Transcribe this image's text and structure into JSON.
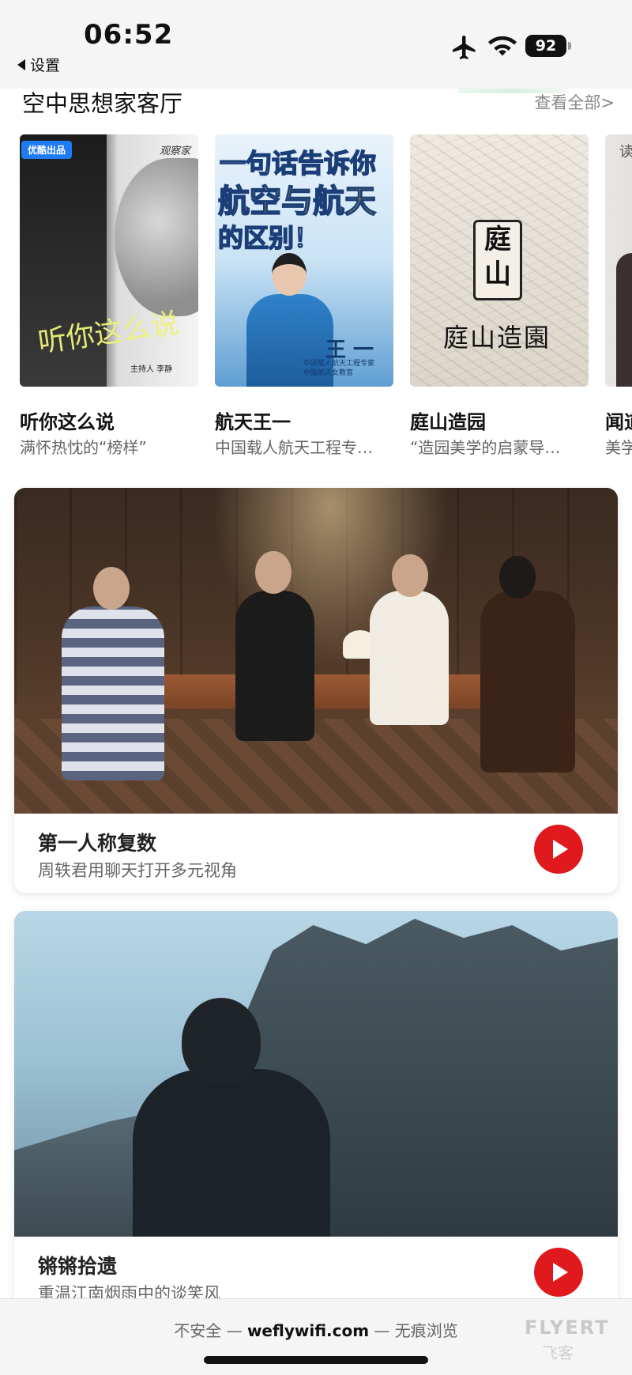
{
  "status": {
    "time": "06:52",
    "back_label": "设置",
    "battery": "92"
  },
  "section": {
    "title": "空中思想家客厅",
    "see_all": "查看全部>"
  },
  "cards": [
    {
      "title": "听你这么说",
      "subtitle": "满怀热忱的“榜样”",
      "badge": "优酷出品",
      "poster_logo": "观察家",
      "poster_text": "听你这么说",
      "poster_credit": "主持人 李静"
    },
    {
      "title": "航天王一",
      "subtitle": "中国载人航天工程专…",
      "poster_line1": "一句话告诉你",
      "poster_line2": "航空与航天",
      "poster_line3": "的区别！",
      "poster_name": "王 一",
      "poster_caption": "中国载人航天工程专家\n中国航天女教官"
    },
    {
      "title": "庭山造园",
      "subtitle": "“造园美学的启蒙导…",
      "poster_seal": "庭山",
      "poster_title": "庭山造園"
    },
    {
      "title": "闻道",
      "subtitle": "美学",
      "poster_char": "读"
    }
  ],
  "videos": [
    {
      "title": "第一人称复数",
      "subtitle": "周轶君用聊天打开多元视角"
    },
    {
      "title": "锵锵拾遗",
      "subtitle": "重温江南烟雨中的谈笑风"
    }
  ],
  "browser": {
    "prefix": "不安全 — ",
    "host": "weflywifi.com",
    "suffix": " — 无痕浏览"
  },
  "watermark": {
    "text": "FLYERT",
    "sub": "飞客"
  }
}
